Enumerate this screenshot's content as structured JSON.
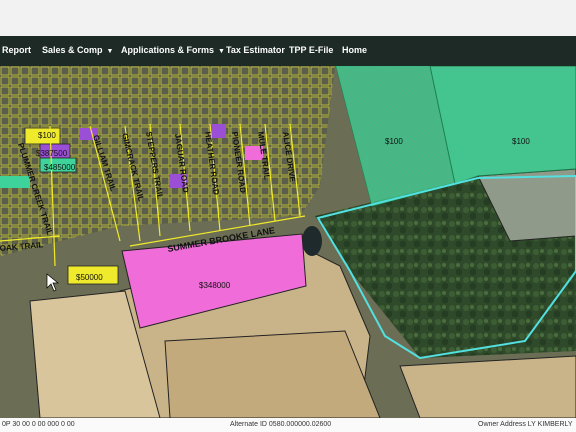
{
  "nav": {
    "items": [
      {
        "label": "Report"
      },
      {
        "label": "Sales & Comp",
        "caret": true
      },
      {
        "label": "Applications & Forms",
        "caret": true
      },
      {
        "label": "Tax Estimator"
      },
      {
        "label": "TPP E-File"
      },
      {
        "label": "Home"
      }
    ]
  },
  "toolbar": {
    "tools": [
      "pan-icon",
      "zoom-in-icon",
      "zoom-out-icon",
      "full-extent-icon",
      "measure-icon",
      "identify-icon",
      "select-icon",
      "layers-icon",
      "print-icon",
      "buffer-icon",
      "draw-icon",
      "clear-icon",
      "refresh-icon",
      "locate-icon",
      "save-icon"
    ]
  },
  "map": {
    "streets": {
      "street_1": "PLUMMER CREEK TRAIL",
      "street_2": "GILLIAM TRAIL",
      "street_3": "GIMCRACK TRAIL",
      "street_4": "STEPPERS TRAIL",
      "street_5": "JAGUAR ROAD",
      "street_6": "HEATHER ROAD",
      "street_7": "PIONEER ROAD",
      "street_8": "MULE TRAIL",
      "street_9": "ALICE DRIVE",
      "street_10": "SUMMER BROOKE LANE",
      "street_11": "OAK TRAIL"
    },
    "values": {
      "v1": "$100",
      "v2": "$387500",
      "v3": "$485000",
      "v4": "$50000",
      "v5": "$348000",
      "v6": "$100",
      "v7": "$100"
    },
    "colors": {
      "pink_parcel": "#f06cd8",
      "green_parcel": "#3ed39a",
      "selected_outline": "#53e0e0",
      "parcel_yellow": "#f0ea2c",
      "parcel_purple": "#9a4fd6"
    }
  },
  "status": {
    "parcel_partial": "0P 30 00 0 00 000 0 00",
    "alternate_id": "Alternate ID 0580.000000.02600",
    "owner_address": "Owner Address LY KIMBERLY"
  }
}
